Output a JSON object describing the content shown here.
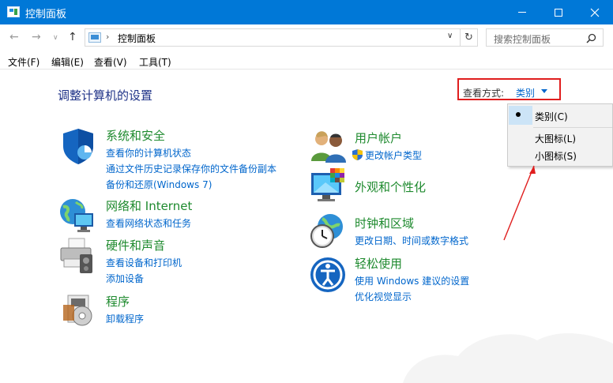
{
  "window": {
    "title": "控制面板",
    "minimize_icon": "minimize-icon",
    "maximize_icon": "maximize-icon",
    "close_icon": "close-icon"
  },
  "address_bar": {
    "separator": "›",
    "path": "控制面板",
    "search_placeholder": "搜索控制面板",
    "refresh_glyph": "↻",
    "dropdown_glyph": "∨",
    "search_glyph": "⚲"
  },
  "nav": {
    "back": "←",
    "forward": "→",
    "recent": "∨",
    "up": "↑"
  },
  "menu": {
    "file": "文件(F)",
    "edit": "编辑(E)",
    "view": "查看(V)",
    "tools": "工具(T)"
  },
  "main": {
    "title": "调整计算机的设置",
    "view_by_label": "查看方式:",
    "view_by_value": "类别"
  },
  "categories_left": [
    {
      "title": "系统和安全",
      "links": [
        "查看你的计算机状态",
        "通过文件历史记录保存你的文件备份副本",
        "备份和还原(Windows 7)"
      ]
    },
    {
      "title": "网络和 Internet",
      "links": [
        "查看网络状态和任务"
      ]
    },
    {
      "title": "硬件和声音",
      "links": [
        "查看设备和打印机",
        "添加设备"
      ]
    },
    {
      "title": "程序",
      "links": [
        "卸载程序"
      ]
    }
  ],
  "categories_right": [
    {
      "title": "用户帐户",
      "links": [
        "更改帐户类型"
      ]
    },
    {
      "title": "外观和个性化",
      "links": []
    },
    {
      "title": "时钟和区域",
      "links": [
        "更改日期、时间或数字格式"
      ]
    },
    {
      "title": "轻松使用",
      "links": [
        "使用 Windows 建议的设置",
        "优化视觉显示"
      ]
    }
  ],
  "dropdown": {
    "options": [
      "类别(C)",
      "大图标(L)",
      "小图标(S)"
    ],
    "selected": "类别(C)"
  },
  "colors": {
    "titlebar": "#0078d7",
    "link": "#0066cc",
    "category_title": "#1e8a2e",
    "page_title": "#1e3287",
    "annotation": "#e01e1e"
  }
}
